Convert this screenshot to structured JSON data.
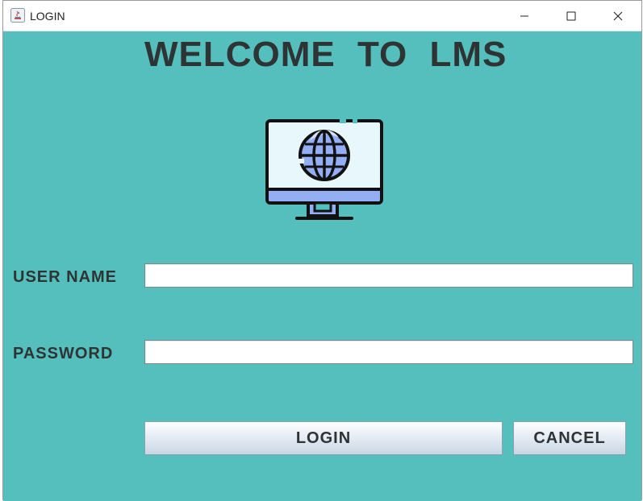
{
  "window": {
    "title": "LOGIN"
  },
  "header": {
    "heading": "WELCOME  TO  LMS"
  },
  "form": {
    "username_label": "USER NAME",
    "username_value": "",
    "password_label": "PASSWORD",
    "password_value": ""
  },
  "buttons": {
    "login_label": "LOGIN",
    "cancel_label": "CANCEL"
  },
  "icons": {
    "app": "java-app-icon",
    "logo": "monitor-globe-icon",
    "minimize": "minimize-icon",
    "maximize": "maximize-icon",
    "close": "close-icon"
  },
  "colors": {
    "background": "#54bfbd",
    "text": "#2e3333"
  }
}
